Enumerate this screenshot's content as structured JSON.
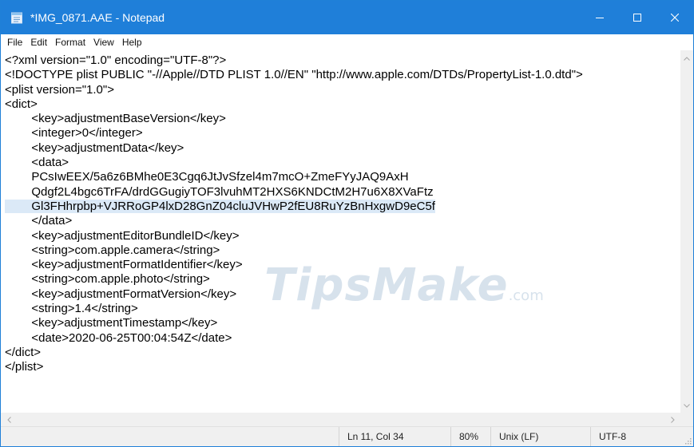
{
  "window": {
    "title": "*IMG_0871.AAE - Notepad",
    "app_icon": "notepad-icon",
    "controls": {
      "minimize_icon": "minimize-icon",
      "maximize_icon": "maximize-icon",
      "close_icon": "close-icon"
    }
  },
  "colors": {
    "titlebar": "#1f7fd9",
    "selection_highlight": "#dbe9f7"
  },
  "menu": {
    "items": [
      "File",
      "Edit",
      "Format",
      "View",
      "Help"
    ]
  },
  "editor": {
    "lines": [
      "<?xml version=\"1.0\" encoding=\"UTF-8\"?>",
      "<!DOCTYPE plist PUBLIC \"-//Apple//DTD PLIST 1.0//EN\" \"http://www.apple.com/DTDs/PropertyList-1.0.dtd\">",
      "<plist version=\"1.0\">",
      "<dict>",
      "\t<key>adjustmentBaseVersion</key>",
      "\t<integer>0</integer>",
      "\t<key>adjustmentData</key>",
      "\t<data>",
      "\tPCsIwEEX/5a6z6BMhe0E3Cgq6JtJvSfzel4m7mcO+ZmeFYyJAQ9AxH",
      "\tQdgf2L4bgc6TrFA/drdGGugiyTOF3lvuhMT2HXS6KNDCtM2H7u6X8XVaFtz",
      "\tGl3FHhrpbp+VJRRoGP4lxD28GnZ04cluJVHwP2fEU8RuYzBnHxgwD9eC5f",
      "\t</data>",
      "\t<key>adjustmentEditorBundleID</key>",
      "\t<string>com.apple.camera</string>",
      "\t<key>adjustmentFormatIdentifier</key>",
      "\t<string>com.apple.photo</string>",
      "\t<key>adjustmentFormatVersion</key>",
      "\t<string>1.4</string>",
      "\t<key>adjustmentTimestamp</key>",
      "\t<date>2020-06-25T00:04:54Z</date>",
      "</dict>",
      "</plist>"
    ],
    "watermark": {
      "brand": "TipsMake",
      "suffix": ".com"
    }
  },
  "status": {
    "position": "Ln 11, Col 34",
    "zoom": "80%",
    "line_ending": "Unix (LF)",
    "encoding": "UTF-8"
  }
}
